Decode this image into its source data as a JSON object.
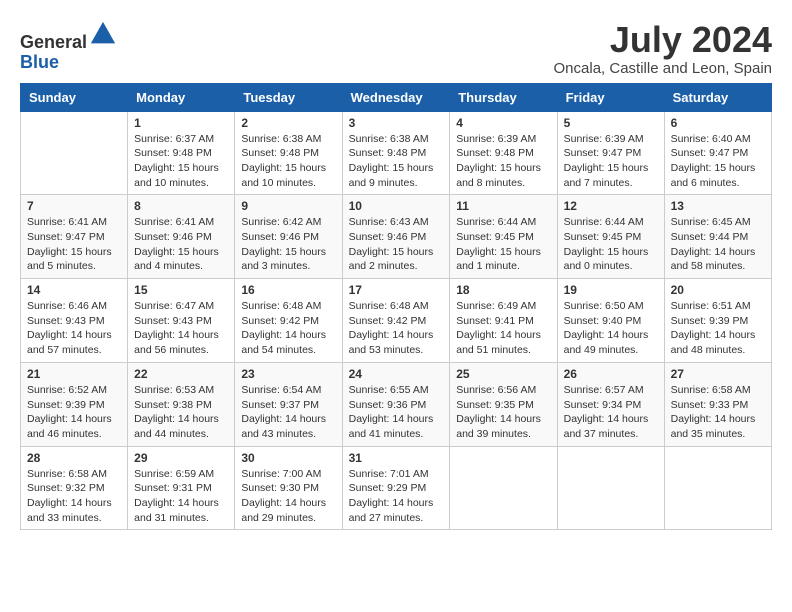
{
  "header": {
    "logo_line1": "General",
    "logo_line2": "Blue",
    "month_year": "July 2024",
    "location": "Oncala, Castille and Leon, Spain"
  },
  "weekdays": [
    "Sunday",
    "Monday",
    "Tuesday",
    "Wednesday",
    "Thursday",
    "Friday",
    "Saturday"
  ],
  "weeks": [
    [
      {
        "day": "",
        "info": ""
      },
      {
        "day": "1",
        "info": "Sunrise: 6:37 AM\nSunset: 9:48 PM\nDaylight: 15 hours\nand 10 minutes."
      },
      {
        "day": "2",
        "info": "Sunrise: 6:38 AM\nSunset: 9:48 PM\nDaylight: 15 hours\nand 10 minutes."
      },
      {
        "day": "3",
        "info": "Sunrise: 6:38 AM\nSunset: 9:48 PM\nDaylight: 15 hours\nand 9 minutes."
      },
      {
        "day": "4",
        "info": "Sunrise: 6:39 AM\nSunset: 9:48 PM\nDaylight: 15 hours\nand 8 minutes."
      },
      {
        "day": "5",
        "info": "Sunrise: 6:39 AM\nSunset: 9:47 PM\nDaylight: 15 hours\nand 7 minutes."
      },
      {
        "day": "6",
        "info": "Sunrise: 6:40 AM\nSunset: 9:47 PM\nDaylight: 15 hours\nand 6 minutes."
      }
    ],
    [
      {
        "day": "7",
        "info": "Sunrise: 6:41 AM\nSunset: 9:47 PM\nDaylight: 15 hours\nand 5 minutes."
      },
      {
        "day": "8",
        "info": "Sunrise: 6:41 AM\nSunset: 9:46 PM\nDaylight: 15 hours\nand 4 minutes."
      },
      {
        "day": "9",
        "info": "Sunrise: 6:42 AM\nSunset: 9:46 PM\nDaylight: 15 hours\nand 3 minutes."
      },
      {
        "day": "10",
        "info": "Sunrise: 6:43 AM\nSunset: 9:46 PM\nDaylight: 15 hours\nand 2 minutes."
      },
      {
        "day": "11",
        "info": "Sunrise: 6:44 AM\nSunset: 9:45 PM\nDaylight: 15 hours\nand 1 minute."
      },
      {
        "day": "12",
        "info": "Sunrise: 6:44 AM\nSunset: 9:45 PM\nDaylight: 15 hours\nand 0 minutes."
      },
      {
        "day": "13",
        "info": "Sunrise: 6:45 AM\nSunset: 9:44 PM\nDaylight: 14 hours\nand 58 minutes."
      }
    ],
    [
      {
        "day": "14",
        "info": "Sunrise: 6:46 AM\nSunset: 9:43 PM\nDaylight: 14 hours\nand 57 minutes."
      },
      {
        "day": "15",
        "info": "Sunrise: 6:47 AM\nSunset: 9:43 PM\nDaylight: 14 hours\nand 56 minutes."
      },
      {
        "day": "16",
        "info": "Sunrise: 6:48 AM\nSunset: 9:42 PM\nDaylight: 14 hours\nand 54 minutes."
      },
      {
        "day": "17",
        "info": "Sunrise: 6:48 AM\nSunset: 9:42 PM\nDaylight: 14 hours\nand 53 minutes."
      },
      {
        "day": "18",
        "info": "Sunrise: 6:49 AM\nSunset: 9:41 PM\nDaylight: 14 hours\nand 51 minutes."
      },
      {
        "day": "19",
        "info": "Sunrise: 6:50 AM\nSunset: 9:40 PM\nDaylight: 14 hours\nand 49 minutes."
      },
      {
        "day": "20",
        "info": "Sunrise: 6:51 AM\nSunset: 9:39 PM\nDaylight: 14 hours\nand 48 minutes."
      }
    ],
    [
      {
        "day": "21",
        "info": "Sunrise: 6:52 AM\nSunset: 9:39 PM\nDaylight: 14 hours\nand 46 minutes."
      },
      {
        "day": "22",
        "info": "Sunrise: 6:53 AM\nSunset: 9:38 PM\nDaylight: 14 hours\nand 44 minutes."
      },
      {
        "day": "23",
        "info": "Sunrise: 6:54 AM\nSunset: 9:37 PM\nDaylight: 14 hours\nand 43 minutes."
      },
      {
        "day": "24",
        "info": "Sunrise: 6:55 AM\nSunset: 9:36 PM\nDaylight: 14 hours\nand 41 minutes."
      },
      {
        "day": "25",
        "info": "Sunrise: 6:56 AM\nSunset: 9:35 PM\nDaylight: 14 hours\nand 39 minutes."
      },
      {
        "day": "26",
        "info": "Sunrise: 6:57 AM\nSunset: 9:34 PM\nDaylight: 14 hours\nand 37 minutes."
      },
      {
        "day": "27",
        "info": "Sunrise: 6:58 AM\nSunset: 9:33 PM\nDaylight: 14 hours\nand 35 minutes."
      }
    ],
    [
      {
        "day": "28",
        "info": "Sunrise: 6:58 AM\nSunset: 9:32 PM\nDaylight: 14 hours\nand 33 minutes."
      },
      {
        "day": "29",
        "info": "Sunrise: 6:59 AM\nSunset: 9:31 PM\nDaylight: 14 hours\nand 31 minutes."
      },
      {
        "day": "30",
        "info": "Sunrise: 7:00 AM\nSunset: 9:30 PM\nDaylight: 14 hours\nand 29 minutes."
      },
      {
        "day": "31",
        "info": "Sunrise: 7:01 AM\nSunset: 9:29 PM\nDaylight: 14 hours\nand 27 minutes."
      },
      {
        "day": "",
        "info": ""
      },
      {
        "day": "",
        "info": ""
      },
      {
        "day": "",
        "info": ""
      }
    ]
  ]
}
